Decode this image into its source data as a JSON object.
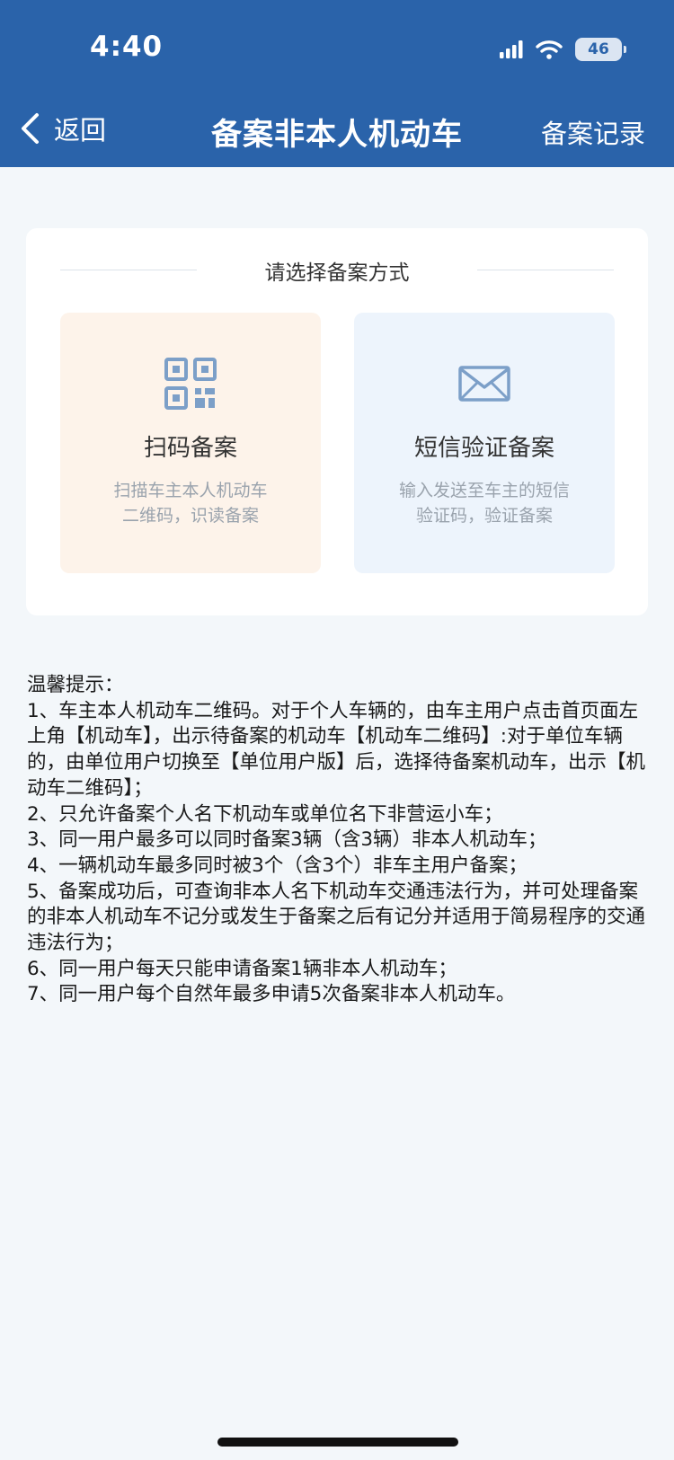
{
  "status_bar": {
    "time": "4:40",
    "battery_level": "46",
    "icons": [
      "signal-icon",
      "wifi-icon",
      "battery-icon"
    ]
  },
  "nav": {
    "back_label": "返回",
    "title": "备案非本人机动车",
    "records_label": "备案记录"
  },
  "card": {
    "title": "请选择备案方式",
    "options": [
      {
        "icon": "qr-code-icon",
        "title": "扫码备案",
        "desc_line1": "扫描车主本人机动车",
        "desc_line2": "二维码，识读备案"
      },
      {
        "icon": "envelope-icon",
        "title": "短信验证备案",
        "desc_line1": "输入发送至车主的短信",
        "desc_line2": "验证码，验证备案"
      }
    ]
  },
  "tips": {
    "title": "温馨提示：",
    "items": [
      "1、车主本人机动车二维码。对于个人车辆的，由车主用户点击首页面左上角【机动车】，出示待备案的机动车【机动车二维码】:对于单位车辆的，由单位用户切换至【单位用户版】后，选择待备案机动车，出示【机动车二维码】；",
      "2、只允许备案个人名下机动车或单位名下非营运小车；",
      "3、同一用户最多可以同时备案3辆（含3辆）非本人机动车；",
      "4、一辆机动车最多同时被3个（含3个）非车主用户备案；",
      "5、备案成功后，可查询非本人名下机动车交通违法行为，并可处理备案的非本人机动车不记分或发生于备案之后有记分并适用于简易程序的交通违法行为；",
      "6、同一用户每天只能申请备案1辆非本人机动车；",
      "7、同一用户每个自然年最多申请5次备案非本人机动车。"
    ]
  },
  "colors": {
    "header_bg": "#2a63aa",
    "page_bg": "#f3f7fa",
    "scan_option_bg": "#fdf3ea",
    "sms_option_bg": "#edf4fc",
    "icon_color": "#7c9fc8"
  }
}
